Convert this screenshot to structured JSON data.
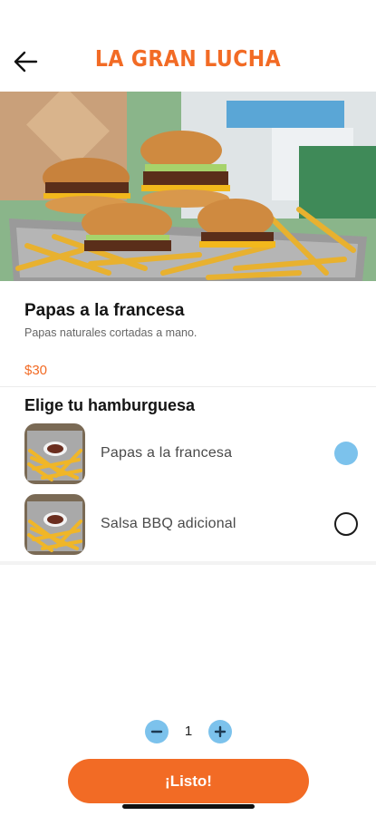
{
  "header": {
    "title": "LA GRAN LUCHA",
    "back_icon": "arrow-left-icon"
  },
  "product": {
    "name": "Papas a la francesa",
    "description": "Papas naturales cortadas a mano.",
    "price": "$30"
  },
  "options_section": {
    "title": "Elige tu hamburguesa",
    "options": [
      {
        "label": "Papas a la francesa",
        "selected": true
      },
      {
        "label": "Salsa BBQ adicional",
        "selected": false
      }
    ]
  },
  "quantity": {
    "value": "1",
    "minus_icon": "minus-circle-icon",
    "plus_icon": "plus-circle-icon"
  },
  "actions": {
    "done_label": "¡Listo!"
  },
  "colors": {
    "brand": "#f26b25",
    "accent": "#7cc2ec"
  }
}
